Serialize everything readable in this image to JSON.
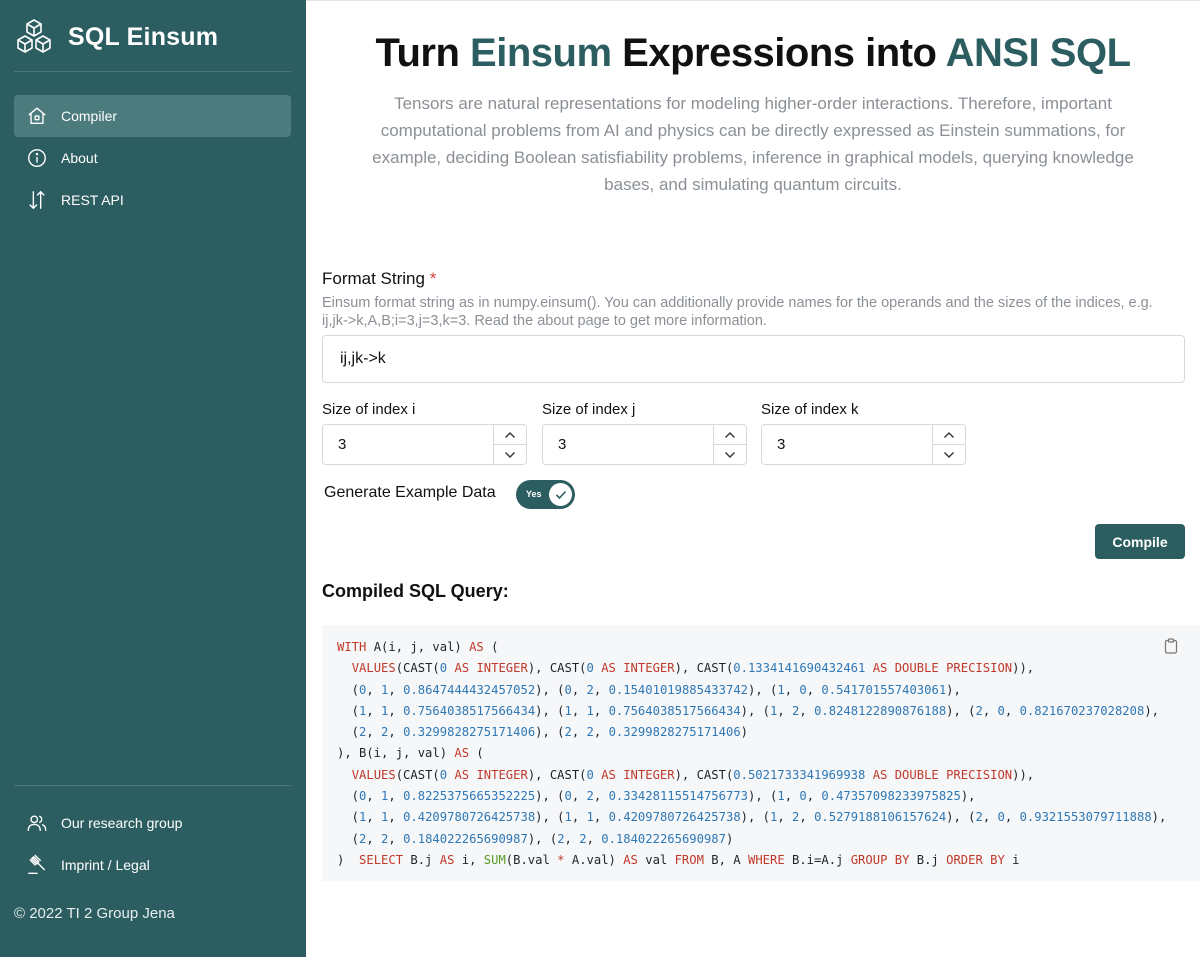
{
  "sidebar": {
    "brand": "SQL Einsum",
    "nav": [
      {
        "label": "Compiler",
        "icon": "home-icon",
        "active": true
      },
      {
        "label": "About",
        "icon": "info-icon",
        "active": false
      },
      {
        "label": "REST API",
        "icon": "arrows-up-down-icon",
        "active": false
      }
    ],
    "footer_nav": [
      {
        "label": "Our research group",
        "icon": "users-icon"
      },
      {
        "label": "Imprint / Legal",
        "icon": "gavel-icon"
      }
    ],
    "copyright": "© 2022 TI 2 Group Jena",
    "colors": {
      "background": "#2c5d60",
      "active_item": "#4b7b7d"
    }
  },
  "header": {
    "title_part1": "Turn",
    "title_accent1": "Einsum",
    "title_part2": "Expressions into",
    "title_accent2": "ANSI SQL",
    "subtitle": "Tensors are natural representations for modeling higher-order interactions. Therefore, important computational problems from AI and physics can be directly expressed as Einstein summations, for example, deciding Boolean satisfiability problems, inference in graphical models, querying knowledge bases, and simulating quantum circuits."
  },
  "form": {
    "format_label": "Format String",
    "required_mark": "*",
    "format_help": "Einsum format string as in numpy.einsum(). You can additionally provide names for the operands and the sizes of the indices, e.g. ij,jk->k,A,B;i=3,j=3,k=3. Read the about page to get more information.",
    "format_value": "ij,jk->k",
    "sizes": [
      {
        "label": "Size of index i",
        "value": "3"
      },
      {
        "label": "Size of index j",
        "value": "3"
      },
      {
        "label": "Size of index k",
        "value": "3"
      }
    ],
    "toggle_label": "Generate Example Data",
    "toggle_text": "Yes",
    "toggle_on": true,
    "compile_label": "Compile"
  },
  "result": {
    "title": "Compiled SQL Query:",
    "copy_icon": "clipboard-icon",
    "code_lines": [
      [
        [
          "kw",
          "WITH"
        ],
        [
          "t",
          " A(i, j, val) "
        ],
        [
          "kw",
          "AS"
        ],
        [
          "t",
          " ("
        ]
      ],
      [
        [
          "t",
          "  "
        ],
        [
          "kw",
          "VALUES"
        ],
        [
          "t",
          "(CAST("
        ],
        [
          "num",
          "0"
        ],
        [
          "t",
          " "
        ],
        [
          "kw",
          "AS INTEGER"
        ],
        [
          "t",
          "), CAST("
        ],
        [
          "num",
          "0"
        ],
        [
          "t",
          " "
        ],
        [
          "kw",
          "AS INTEGER"
        ],
        [
          "t",
          "), CAST("
        ],
        [
          "num",
          "0.1334141690432461"
        ],
        [
          "t",
          " "
        ],
        [
          "kw",
          "AS DOUBLE PRECISION"
        ],
        [
          "t",
          ")),"
        ]
      ],
      [
        [
          "t",
          "  ("
        ],
        [
          "num",
          "0"
        ],
        [
          "t",
          ", "
        ],
        [
          "num",
          "1"
        ],
        [
          "t",
          ", "
        ],
        [
          "num",
          "0.8647444432457052"
        ],
        [
          "t",
          "), ("
        ],
        [
          "num",
          "0"
        ],
        [
          "t",
          ", "
        ],
        [
          "num",
          "2"
        ],
        [
          "t",
          ", "
        ],
        [
          "num",
          "0.15401019885433742"
        ],
        [
          "t",
          "), ("
        ],
        [
          "num",
          "1"
        ],
        [
          "t",
          ", "
        ],
        [
          "num",
          "0"
        ],
        [
          "t",
          ", "
        ],
        [
          "num",
          "0.541701557403061"
        ],
        [
          "t",
          "),"
        ]
      ],
      [
        [
          "t",
          "  ("
        ],
        [
          "num",
          "1"
        ],
        [
          "t",
          ", "
        ],
        [
          "num",
          "1"
        ],
        [
          "t",
          ", "
        ],
        [
          "num",
          "0.7564038517566434"
        ],
        [
          "t",
          "), ("
        ],
        [
          "num",
          "1"
        ],
        [
          "t",
          ", "
        ],
        [
          "num",
          "1"
        ],
        [
          "t",
          ", "
        ],
        [
          "num",
          "0.7564038517566434"
        ],
        [
          "t",
          "), ("
        ],
        [
          "num",
          "1"
        ],
        [
          "t",
          ", "
        ],
        [
          "num",
          "2"
        ],
        [
          "t",
          ", "
        ],
        [
          "num",
          "0.8248122890876188"
        ],
        [
          "t",
          "), ("
        ],
        [
          "num",
          "2"
        ],
        [
          "t",
          ", "
        ],
        [
          "num",
          "0"
        ],
        [
          "t",
          ", "
        ],
        [
          "num",
          "0.821670237028208"
        ],
        [
          "t",
          "),"
        ]
      ],
      [
        [
          "t",
          "  ("
        ],
        [
          "num",
          "2"
        ],
        [
          "t",
          ", "
        ],
        [
          "num",
          "2"
        ],
        [
          "t",
          ", "
        ],
        [
          "num",
          "0.3299828275171406"
        ],
        [
          "t",
          "), ("
        ],
        [
          "num",
          "2"
        ],
        [
          "t",
          ", "
        ],
        [
          "num",
          "2"
        ],
        [
          "t",
          ", "
        ],
        [
          "num",
          "0.3299828275171406"
        ],
        [
          "t",
          ")"
        ]
      ],
      [
        [
          "t",
          "), B(i, j, val) "
        ],
        [
          "kw",
          "AS"
        ],
        [
          "t",
          " ("
        ]
      ],
      [
        [
          "t",
          "  "
        ],
        [
          "kw",
          "VALUES"
        ],
        [
          "t",
          "(CAST("
        ],
        [
          "num",
          "0"
        ],
        [
          "t",
          " "
        ],
        [
          "kw",
          "AS INTEGER"
        ],
        [
          "t",
          "), CAST("
        ],
        [
          "num",
          "0"
        ],
        [
          "t",
          " "
        ],
        [
          "kw",
          "AS INTEGER"
        ],
        [
          "t",
          "), CAST("
        ],
        [
          "num",
          "0.5021733341969938"
        ],
        [
          "t",
          " "
        ],
        [
          "kw",
          "AS DOUBLE PRECISION"
        ],
        [
          "t",
          ")),"
        ]
      ],
      [
        [
          "t",
          "  ("
        ],
        [
          "num",
          "0"
        ],
        [
          "t",
          ", "
        ],
        [
          "num",
          "1"
        ],
        [
          "t",
          ", "
        ],
        [
          "num",
          "0.8225375665352225"
        ],
        [
          "t",
          "), ("
        ],
        [
          "num",
          "0"
        ],
        [
          "t",
          ", "
        ],
        [
          "num",
          "2"
        ],
        [
          "t",
          ", "
        ],
        [
          "num",
          "0.33428115514756773"
        ],
        [
          "t",
          "), ("
        ],
        [
          "num",
          "1"
        ],
        [
          "t",
          ", "
        ],
        [
          "num",
          "0"
        ],
        [
          "t",
          ", "
        ],
        [
          "num",
          "0.47357098233975825"
        ],
        [
          "t",
          "),"
        ]
      ],
      [
        [
          "t",
          "  ("
        ],
        [
          "num",
          "1"
        ],
        [
          "t",
          ", "
        ],
        [
          "num",
          "1"
        ],
        [
          "t",
          ", "
        ],
        [
          "num",
          "0.4209780726425738"
        ],
        [
          "t",
          "), ("
        ],
        [
          "num",
          "1"
        ],
        [
          "t",
          ", "
        ],
        [
          "num",
          "1"
        ],
        [
          "t",
          ", "
        ],
        [
          "num",
          "0.4209780726425738"
        ],
        [
          "t",
          "), ("
        ],
        [
          "num",
          "1"
        ],
        [
          "t",
          ", "
        ],
        [
          "num",
          "2"
        ],
        [
          "t",
          ", "
        ],
        [
          "num",
          "0.5279188106157624"
        ],
        [
          "t",
          "), ("
        ],
        [
          "num",
          "2"
        ],
        [
          "t",
          ", "
        ],
        [
          "num",
          "0"
        ],
        [
          "t",
          ", "
        ],
        [
          "num",
          "0.9321553079711888"
        ],
        [
          "t",
          "),"
        ]
      ],
      [
        [
          "t",
          "  ("
        ],
        [
          "num",
          "2"
        ],
        [
          "t",
          ", "
        ],
        [
          "num",
          "2"
        ],
        [
          "t",
          ", "
        ],
        [
          "num",
          "0.184022265690987"
        ],
        [
          "t",
          "), ("
        ],
        [
          "num",
          "2"
        ],
        [
          "t",
          ", "
        ],
        [
          "num",
          "2"
        ],
        [
          "t",
          ", "
        ],
        [
          "num",
          "0.184022265690987"
        ],
        [
          "t",
          ")"
        ]
      ],
      [
        [
          "t",
          ")  "
        ],
        [
          "kw",
          "SELECT"
        ],
        [
          "t",
          " B.j "
        ],
        [
          "kw",
          "AS"
        ],
        [
          "t",
          " i, "
        ],
        [
          "fn",
          "SUM"
        ],
        [
          "t",
          "(B.val "
        ],
        [
          "kw",
          "*"
        ],
        [
          "t",
          " A.val) "
        ],
        [
          "kw",
          "AS"
        ],
        [
          "t",
          " val "
        ],
        [
          "kw",
          "FROM"
        ],
        [
          "t",
          " B, A "
        ],
        [
          "kw",
          "WHERE"
        ],
        [
          "t",
          " B.i=A.j "
        ],
        [
          "kw",
          "GROUP BY"
        ],
        [
          "t",
          " B.j "
        ],
        [
          "kw",
          "ORDER BY"
        ],
        [
          "t",
          " i"
        ]
      ]
    ]
  }
}
